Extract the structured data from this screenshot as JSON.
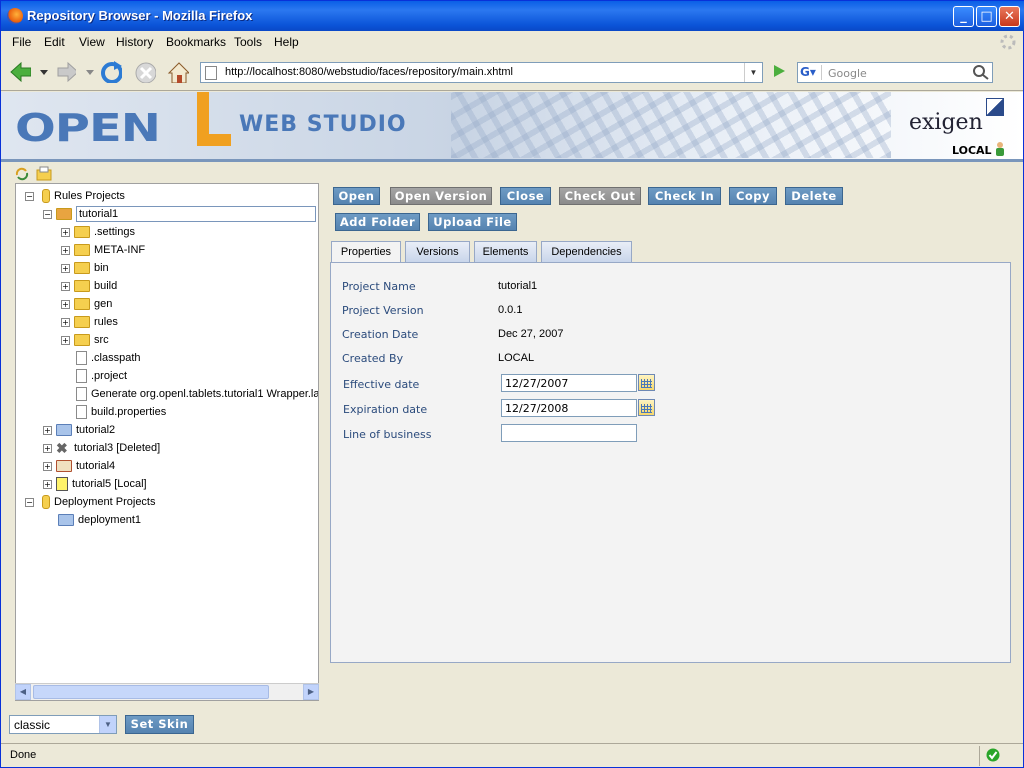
{
  "window": {
    "title": "Repository Browser - Mozilla Firefox",
    "minimize": "_",
    "maximize": "□",
    "close": "✕"
  },
  "menu": [
    "File",
    "Edit",
    "View",
    "History",
    "Bookmarks",
    "Tools",
    "Help"
  ],
  "nav": {
    "url": "http://localhost:8080/webstudio/faces/repository/main.xhtml",
    "search_placeholder": "Google"
  },
  "header": {
    "logo_open": "OPEN",
    "logo_l": "L",
    "logo_webstudio": "WEB STUDIO",
    "brand": "exigen",
    "user": "LOCAL"
  },
  "toolbar": {
    "row1": [
      "Open",
      "Open Version",
      "Close",
      "Check Out",
      "Check In",
      "Copy",
      "Delete"
    ],
    "row2": [
      "Add Folder",
      "Upload File"
    ]
  },
  "tabs": [
    "Properties",
    "Versions",
    "Elements",
    "Dependencies"
  ],
  "tree": {
    "rules_projects": "Rules Projects",
    "tutorial1": "tutorial1",
    "children": [
      ".settings",
      "META-INF",
      "bin",
      "build",
      "gen",
      "rules",
      "src",
      ".classpath",
      ".project",
      "Generate org.openl.tablets.tutorial1 Wrapper.la",
      "build.properties"
    ],
    "tutorial2": "tutorial2",
    "tutorial3": "tutorial3 [Deleted]",
    "tutorial4": "tutorial4",
    "tutorial5": "tutorial5 [Local]",
    "deployment_projects": "Deployment Projects",
    "deployment1": "deployment1"
  },
  "properties": {
    "project_name_label": "Project Name",
    "project_name": "tutorial1",
    "project_version_label": "Project Version",
    "project_version": "0.0.1",
    "creation_date_label": "Creation Date",
    "creation_date": "Dec 27, 2007",
    "created_by_label": "Created By",
    "created_by": "LOCAL",
    "effective_date_label": "Effective date",
    "effective_date": "12/27/2007",
    "expiration_date_label": "Expiration date",
    "expiration_date": "12/27/2008",
    "lob_label": "Line of business",
    "lob": ""
  },
  "skin": {
    "selected": "classic",
    "set_label": "Set Skin"
  },
  "status": "Done"
}
